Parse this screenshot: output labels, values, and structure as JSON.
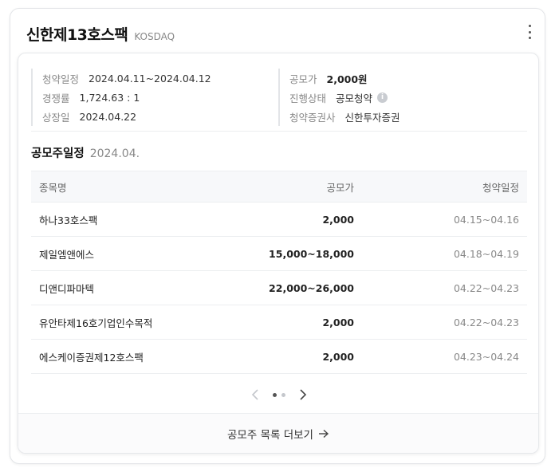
{
  "header": {
    "title": "신한제13호스팩",
    "market": "KOSDAQ",
    "more_icon": "more-vertical-icon"
  },
  "info": {
    "left": [
      {
        "label": "청약일정",
        "value": "2024.04.11~2024.04.12"
      },
      {
        "label": "경쟁률",
        "value": "1,724.63 : 1"
      },
      {
        "label": "상장일",
        "value": "2024.04.22"
      }
    ],
    "right": [
      {
        "label": "공모가",
        "value": "2,000원"
      },
      {
        "label": "진행상태",
        "value": "공모청약",
        "icon": "info-icon"
      },
      {
        "label": "청약증권사",
        "value": "신한투자증권"
      }
    ]
  },
  "schedule": {
    "title": "공모주일정",
    "month": "2024.04.",
    "columns": [
      "종목명",
      "공모가",
      "청약일정"
    ],
    "rows": [
      {
        "name": "하나33호스팩",
        "price": "2,000",
        "dates": "04.15~04.16"
      },
      {
        "name": "제일엠앤에스",
        "price": "15,000~18,000",
        "dates": "04.18~04.19"
      },
      {
        "name": "디앤디파마텍",
        "price": "22,000~26,000",
        "dates": "04.22~04.23"
      },
      {
        "name": "유안타제16호기업인수목적",
        "price": "2,000",
        "dates": "04.22~04.23"
      },
      {
        "name": "에스케이증권제12호스팩",
        "price": "2,000",
        "dates": "04.23~04.24"
      }
    ]
  },
  "pager": {
    "current_page": 1,
    "total_pages": 2
  },
  "footer": {
    "label": "공모주 목록 더보기",
    "icon": "arrow-right-icon"
  },
  "colors": {
    "border": "#e3e5e8",
    "header_bg": "#f7f8fa",
    "muted": "#888888",
    "text": "#222222"
  }
}
